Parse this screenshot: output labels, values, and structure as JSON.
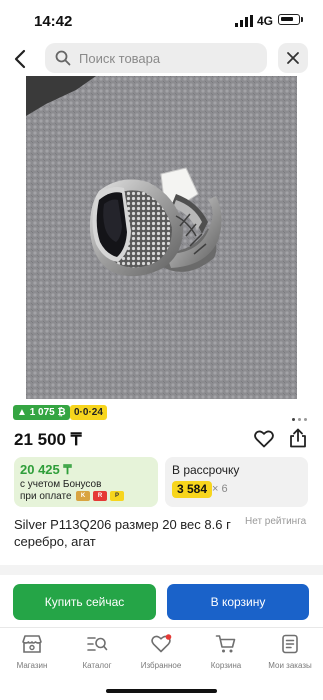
{
  "status_bar": {
    "time": "14:42",
    "network": "4G"
  },
  "search": {
    "placeholder": "Поиск товара"
  },
  "icons": {
    "back": "chevron-left-icon",
    "search": "magnifier-icon",
    "close": "close-icon",
    "favorite": "heart-icon",
    "share": "share-icon"
  },
  "gallery": {
    "images_total": 3,
    "current_index": 0
  },
  "badges": {
    "cashback": "1 075 ₿",
    "installment": "0·0·24"
  },
  "product": {
    "price": "21 500 ₸",
    "title": "Silver P113Q206 размер 20 вес 8.6 г серебро, агат",
    "rating": "Нет рейтинга"
  },
  "bonus": {
    "amount": "20 425 ₸",
    "line1": "с учетом Бонусов",
    "line2": "при оплате"
  },
  "installment": {
    "title": "В рассрочку",
    "monthly": "3 584",
    "multiplier": "× 6"
  },
  "actions": {
    "buy_now": "Купить сейчас",
    "add_to_cart": "В корзину"
  },
  "tabbar": {
    "items": [
      {
        "label": "Магазин",
        "icon": "store-icon"
      },
      {
        "label": "Каталог",
        "icon": "catalog-search-icon"
      },
      {
        "label": "Избранное",
        "icon": "heart-icon"
      },
      {
        "label": "Корзина",
        "icon": "cart-icon"
      },
      {
        "label": "Мои заказы",
        "icon": "orders-icon"
      }
    ]
  },
  "colors": {
    "green": "#25a547",
    "blue": "#1a62c9",
    "yellow": "#f7d51d",
    "badge_red": "#e53935"
  }
}
